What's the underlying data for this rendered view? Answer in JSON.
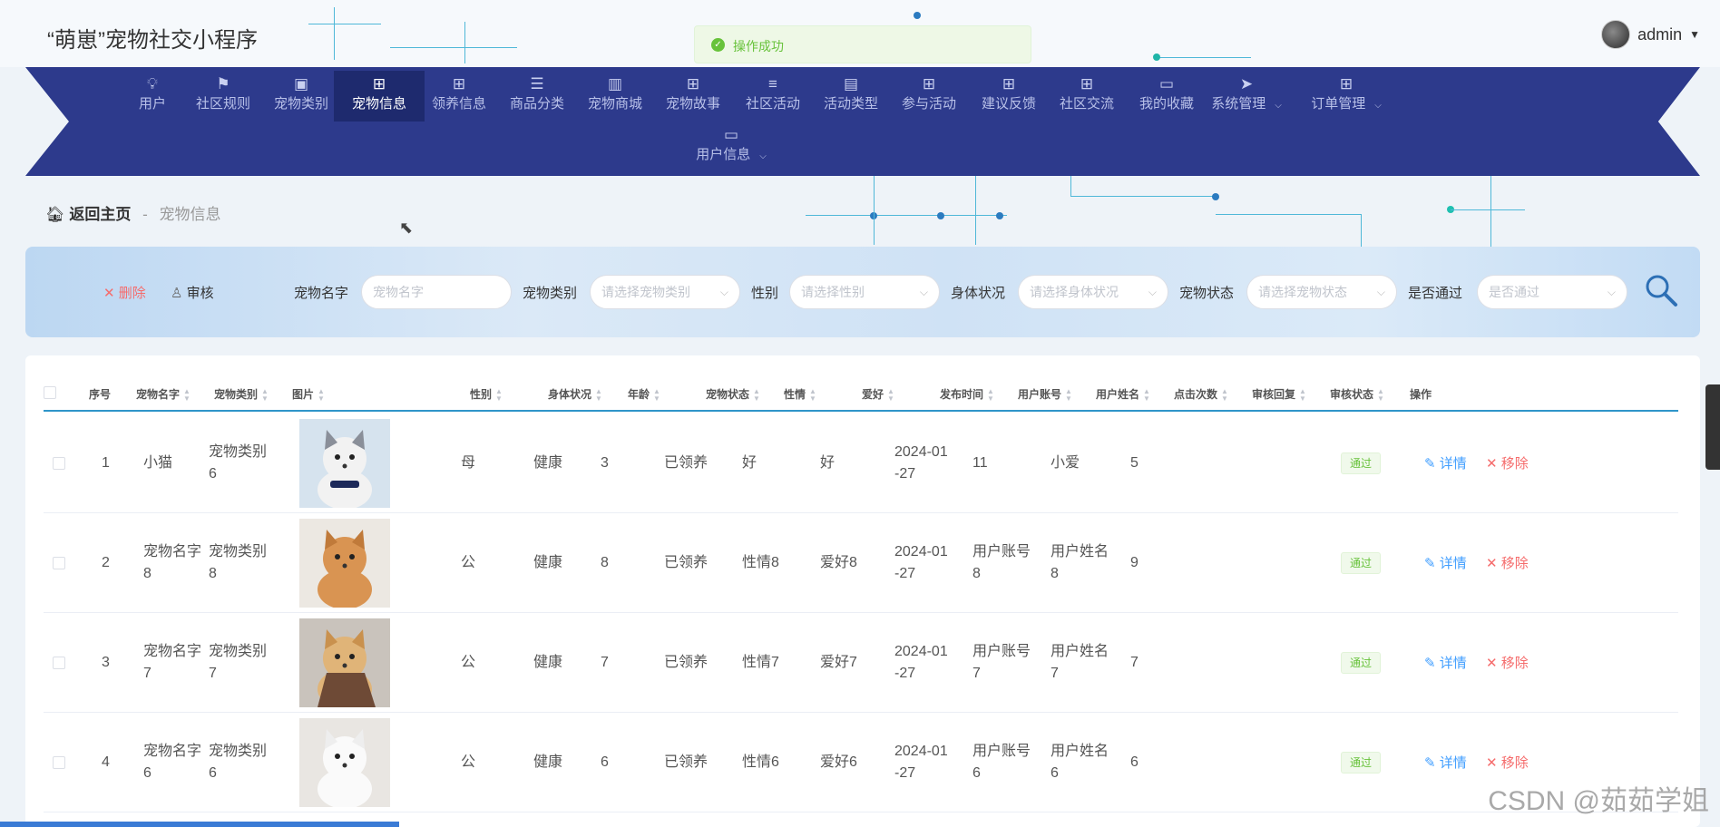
{
  "header": {
    "title": "“萌崽”宠物社交小程序",
    "user": "admin"
  },
  "toast": {
    "text": "操作成功"
  },
  "nav": {
    "items": [
      {
        "label": "用户",
        "icon": "bulb-icon"
      },
      {
        "label": "社区规则",
        "icon": "flag-icon"
      },
      {
        "label": "宠物类别",
        "icon": "chat-icon"
      },
      {
        "label": "宠物信息",
        "icon": "grid-icon",
        "active": true
      },
      {
        "label": "领养信息",
        "icon": "grid-icon"
      },
      {
        "label": "商品分类",
        "icon": "sliders-icon"
      },
      {
        "label": "宠物商城",
        "icon": "books-icon"
      },
      {
        "label": "宠物故事",
        "icon": "grid-icon"
      },
      {
        "label": "社区活动",
        "icon": "list-icon"
      },
      {
        "label": "活动类型",
        "icon": "briefcase-icon"
      },
      {
        "label": "参与活动",
        "icon": "grid-icon"
      },
      {
        "label": "建议反馈",
        "icon": "grid-icon"
      },
      {
        "label": "社区交流",
        "icon": "grid-icon"
      },
      {
        "label": "我的收藏",
        "icon": "monitor-icon"
      },
      {
        "label": "系统管理",
        "icon": "send-icon",
        "has_dropdown": true
      },
      {
        "label": "订单管理",
        "icon": "grid-icon",
        "has_dropdown": true
      },
      {
        "label": "用户信息",
        "icon": "card-icon",
        "has_dropdown": true
      }
    ]
  },
  "breadcrumb": {
    "home": "返回主页",
    "sep": "-",
    "current": "宠物信息"
  },
  "toolbar": {
    "delete_label": "删除",
    "audit_label": "审核"
  },
  "filters": [
    {
      "label": "宠物名字",
      "placeholder": "宠物名字",
      "select": false
    },
    {
      "label": "宠物类别",
      "placeholder": "请选择宠物类别",
      "select": true
    },
    {
      "label": "性别",
      "placeholder": "请选择性别",
      "select": true
    },
    {
      "label": "身体状况",
      "placeholder": "请选择身体状况",
      "select": true
    },
    {
      "label": "宠物状态",
      "placeholder": "请选择宠物状态",
      "select": true
    },
    {
      "label": "是否通过",
      "placeholder": "是否通过",
      "select": true
    }
  ],
  "table": {
    "columns": [
      "序号",
      "宠物名字",
      "宠物类别",
      "图片",
      "性别",
      "身体状况",
      "年龄",
      "宠物状态",
      "性情",
      "爱好",
      "发布时间",
      "用户账号",
      "用户姓名",
      "点击次数",
      "审核回复",
      "审核状态",
      "操作"
    ],
    "detail_label": "详情",
    "remove_label": "移除",
    "rows": [
      {
        "no": "1",
        "name": "小猫",
        "category": "宠物类别\n6",
        "gender": "母",
        "health": "健康",
        "age": "3",
        "status": "已领养",
        "temper": "好",
        "hobby": "好",
        "time": "2024-01\n-27",
        "account": "11",
        "username": "小爱",
        "clicks": "5",
        "reply": "",
        "audit": "通过",
        "img": "cat"
      },
      {
        "no": "2",
        "name": "宠物名字\n8",
        "category": "宠物类别\n8",
        "gender": "公",
        "health": "健康",
        "age": "8",
        "status": "已领养",
        "temper": "性情8",
        "hobby": "爱好8",
        "time": "2024-01\n-27",
        "account": "用户账号\n8",
        "username": "用户姓名\n8",
        "clicks": "9",
        "reply": "",
        "audit": "通过",
        "img": "pom"
      },
      {
        "no": "3",
        "name": "宠物名字\n7",
        "category": "宠物类别\n7",
        "gender": "公",
        "health": "健康",
        "age": "7",
        "status": "已领养",
        "temper": "性情7",
        "hobby": "爱好7",
        "time": "2024-01\n-27",
        "account": "用户账号\n7",
        "username": "用户姓名\n7",
        "clicks": "7",
        "reply": "",
        "audit": "通过",
        "img": "golden"
      },
      {
        "no": "4",
        "name": "宠物名字\n6",
        "category": "宠物类别\n6",
        "gender": "公",
        "health": "健康",
        "age": "6",
        "status": "已领养",
        "temper": "性情6",
        "hobby": "爱好6",
        "time": "2024-01\n-27",
        "account": "用户账号\n6",
        "username": "用户姓名\n6",
        "clicks": "6",
        "reply": "",
        "audit": "通过",
        "img": "white"
      }
    ]
  },
  "watermark": "CSDN @茹茹学姐"
}
